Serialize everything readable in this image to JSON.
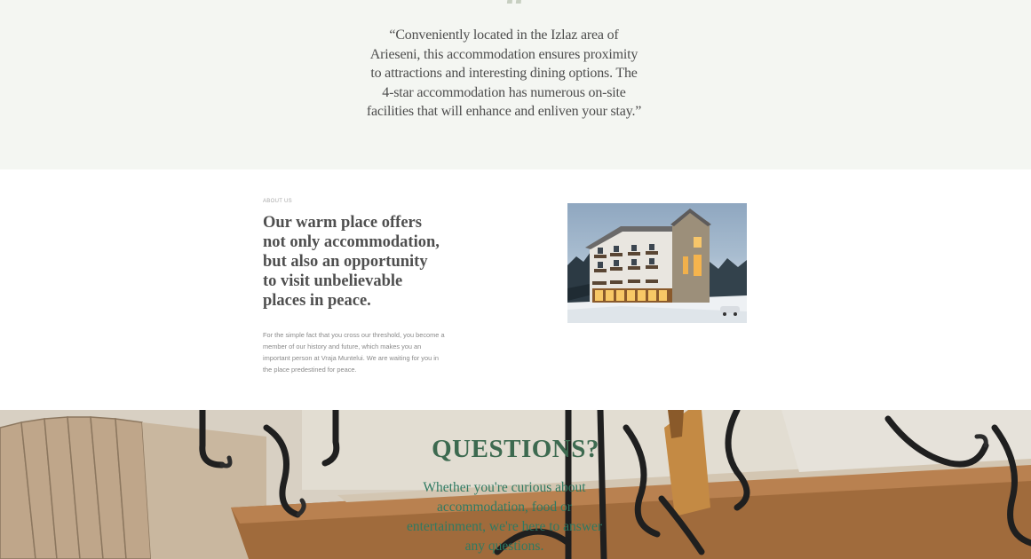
{
  "testimonial": {
    "quote_mark": "“",
    "quote": "“Conveniently located in the Izlaz area of Arieseni, this accommodation ensures proximity to attractions and interesting dining options. The 4-star accommodation has numerous on-site facilities that will enhance and enliven your stay.”"
  },
  "about": {
    "label": "ABOUT US",
    "heading": "Our warm place offers not only accommodation, but also an opportunity to visit unbelievable places in peace.",
    "body": "For the simple fact that you cross our threshold, you become a member of our history and future, which makes you an important person at Vraja Muntelui. We are waiting for you in the place predestined for peace."
  },
  "questions": {
    "title": "QUESTIONS?",
    "text": "Whether you're curious about accommodation, food or entertainment, we're here to answer any questions."
  },
  "colors": {
    "testimonial_bg": "#f4f6f2",
    "accent_green": "#3d6a50",
    "text_teal": "#2f7a62"
  }
}
